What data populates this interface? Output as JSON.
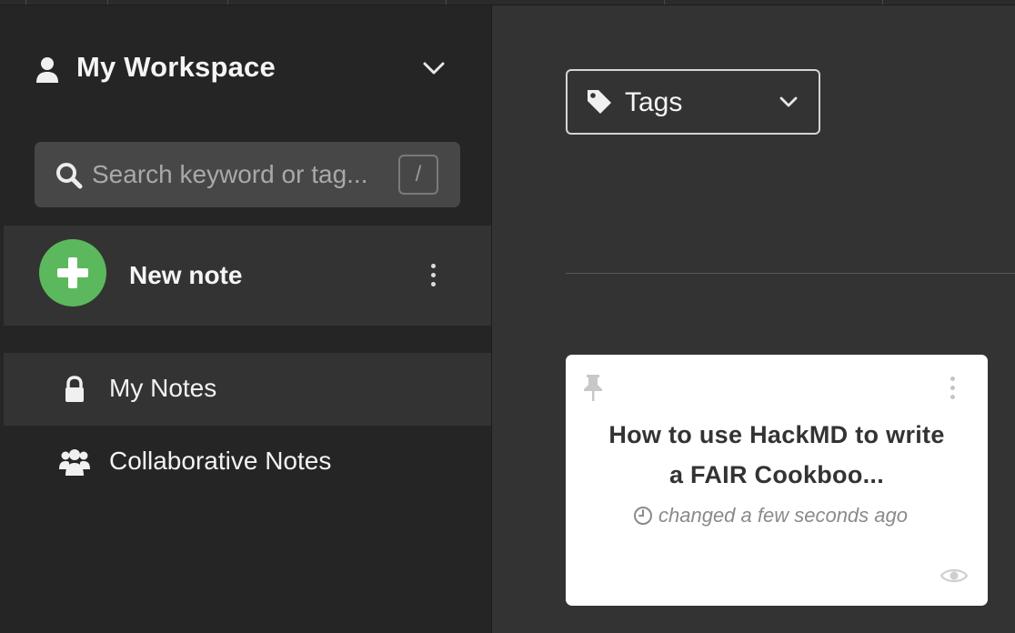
{
  "workspace": {
    "title": "My Workspace",
    "user_icon": "user-icon",
    "chevron_icon": "chevron-down-icon"
  },
  "search": {
    "placeholder": "Search keyword or tag...",
    "shortcut": "/",
    "icon": "search-icon"
  },
  "new_note": {
    "label": "New note",
    "icon": "plus-circle-icon",
    "color": "#5cb85c"
  },
  "nav": {
    "items": [
      {
        "label": "My Notes",
        "icon": "lock-icon",
        "active": true
      },
      {
        "label": "Collaborative Notes",
        "icon": "users-icon",
        "active": false
      }
    ]
  },
  "tags": {
    "label": "Tags",
    "icon": "tag-icon"
  },
  "notes": [
    {
      "title": "How to use HackMD to write a FAIR Cookboo...",
      "time": "changed a few seconds ago",
      "pinned": false
    }
  ],
  "colors": {
    "sidebar_bg": "#252525",
    "main_bg": "#333333",
    "accent_green": "#5cb85c",
    "card_bg": "#ffffff"
  }
}
